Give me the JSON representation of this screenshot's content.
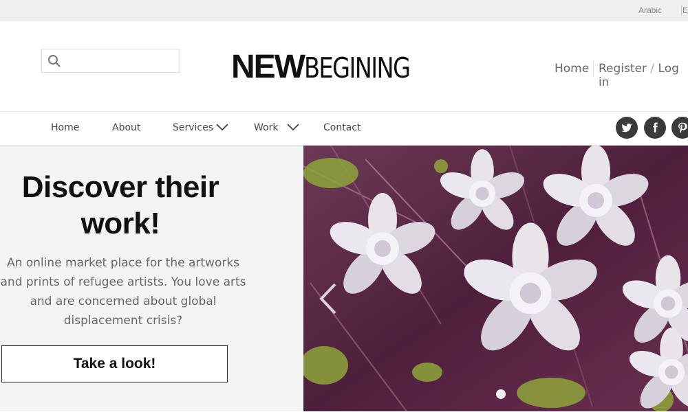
{
  "topbar": {
    "languages": [
      "Arabic",
      "E"
    ]
  },
  "header": {
    "search": {
      "value": "",
      "placeholder": ""
    },
    "logo": {
      "bold": "NEW",
      "light": "BEGINING"
    },
    "nav": {
      "home": "Home",
      "register": "Register",
      "separator": "/",
      "login": "Log in"
    }
  },
  "mainnav": {
    "items": [
      {
        "label": "Home",
        "dropdown": false
      },
      {
        "label": "About",
        "dropdown": false
      },
      {
        "label": "Services",
        "dropdown": true
      },
      {
        "label": "Work",
        "dropdown": true
      },
      {
        "label": "Contact",
        "dropdown": false
      }
    ],
    "social": [
      "twitter-icon",
      "facebook-icon",
      "pinterest-icon"
    ]
  },
  "hero": {
    "title_line1": "Discover their",
    "title_line2": "work!",
    "text_lines": [
      "An online market place for the artworks",
      "and prints of refugee artists. You love arts",
      "and are concerned about global",
      "displacement crisis?"
    ],
    "button": "Take a look!",
    "slides_total": 1,
    "slide_active": 1
  },
  "colors": {
    "text_dark": "#111111",
    "text_muted": "#666666",
    "social_bg": "#3a3a3a",
    "hero_bg": "#f4f4f4",
    "art_base": "#5a2a48"
  }
}
